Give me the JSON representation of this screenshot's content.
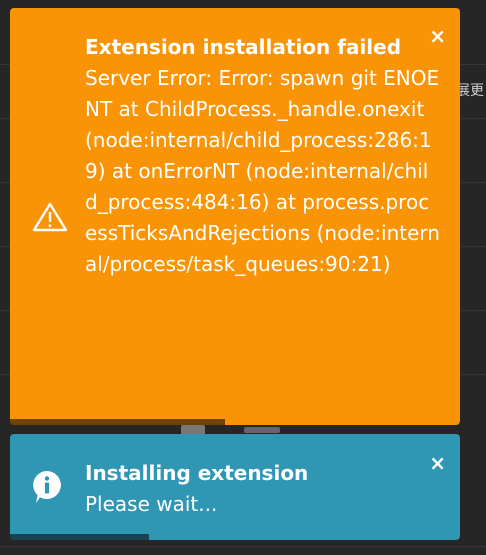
{
  "background": {
    "partial_text": "展更"
  },
  "notifications": [
    {
      "type": "error",
      "icon": "warning-icon",
      "title": "Extension installation failed",
      "message": "Server Error: Error: spawn git ENOENT at ChildProcess._handle.onexit (node:internal/child_process:286:19) at onErrorNT (node:internal/child_process:484:16) at process.processTicksAndRejections (node:internal/process/task_queues:90:21)",
      "close_label": "×",
      "color": "#f89406",
      "progress_fraction": 0.48
    },
    {
      "type": "info",
      "icon": "info-icon",
      "title": "Installing extension",
      "message": "Please wait...",
      "close_label": "×",
      "color": "#2f96b4",
      "progress_fraction": 0.31
    }
  ]
}
